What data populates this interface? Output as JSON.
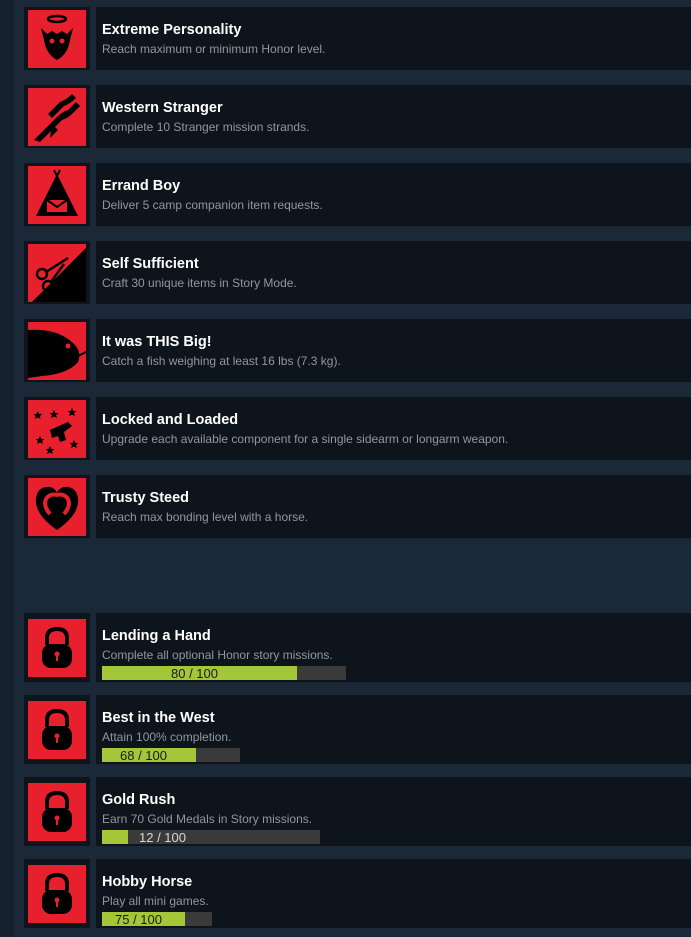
{
  "colors": {
    "background": "#1b2838",
    "card": "#0e141b",
    "icon_red": "#e8202e",
    "title": "#ffffff",
    "description": "#8f98a0",
    "progress_fill": "#a4c639",
    "progress_track": "#3a3a3a"
  },
  "unlocked": [
    {
      "icon": "halo-horned-head-icon",
      "title": "Extreme Personality",
      "description": "Reach maximum or minimum Honor level."
    },
    {
      "icon": "handshake-icon",
      "title": "Western Stranger",
      "description": "Complete 10 Stranger mission strands."
    },
    {
      "icon": "tent-letter-icon",
      "title": "Errand Boy",
      "description": "Deliver 5 camp companion item requests."
    },
    {
      "icon": "scissors-icon",
      "title": "Self Sufficient",
      "description": "Craft 30 unique items in Story Mode."
    },
    {
      "icon": "fish-icon",
      "title": "It was THIS Big!",
      "description": "Catch a fish weighing at least 16 lbs (7.3 kg)."
    },
    {
      "icon": "revolver-sparkle-icon",
      "title": "Locked and Loaded",
      "description": "Upgrade each available component for a single sidearm or longarm weapon."
    },
    {
      "icon": "horseshoe-heart-icon",
      "title": "Trusty Steed",
      "description": "Reach max bonding level with a horse."
    }
  ],
  "locked": [
    {
      "icon": "padlock-icon",
      "title": "Lending a Hand",
      "description": "Complete all optional Honor story missions.",
      "progress": {
        "label": "80 / 100",
        "fraction": 0.8
      }
    },
    {
      "icon": "padlock-icon",
      "title": "Best in the West",
      "description": "Attain 100% completion.",
      "progress": {
        "label": "68 / 100",
        "fraction": 0.68
      }
    },
    {
      "icon": "padlock-icon",
      "title": "Gold Rush",
      "description": "Earn 70 Gold Medals in Story missions.",
      "progress": {
        "label": "12 / 100",
        "fraction": 0.12
      }
    },
    {
      "icon": "padlock-icon",
      "title": "Hobby Horse",
      "description": "Play all mini games.",
      "progress": {
        "label": "75 / 100",
        "fraction": 0.75
      }
    }
  ]
}
